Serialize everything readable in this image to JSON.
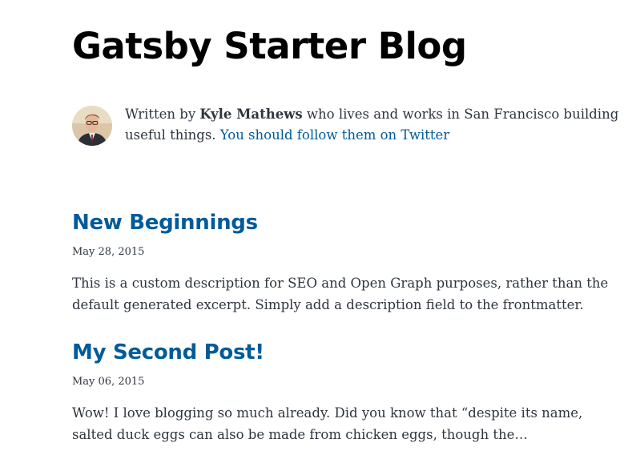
{
  "header": {
    "title": "Gatsby Starter Blog"
  },
  "bio": {
    "prefix": "Written by ",
    "author": "Kyle Mathews",
    "suffix_line1": " who lives and works in San Francisco building",
    "line2": "useful things. ",
    "link_text": "You should follow them on Twitter",
    "avatar_icon": "profile-photo-icon"
  },
  "posts": [
    {
      "title": "New Beginnings",
      "date": "May 28, 2015",
      "description_lines": [
        "This is a custom description for SEO and Open Graph purposes, rather than the",
        "default generated excerpt. Simply add a description field to the frontmatter."
      ]
    },
    {
      "title": "My Second Post!",
      "date": "May 06, 2015",
      "description_lines": [
        "Wow! I love blogging so much already. Did you know that “despite its name,",
        "salted duck eggs can also be made from chicken eggs, though the…"
      ]
    }
  ],
  "colors": {
    "link": "#005b99",
    "text": "#2e353f",
    "heading": "#000000"
  }
}
